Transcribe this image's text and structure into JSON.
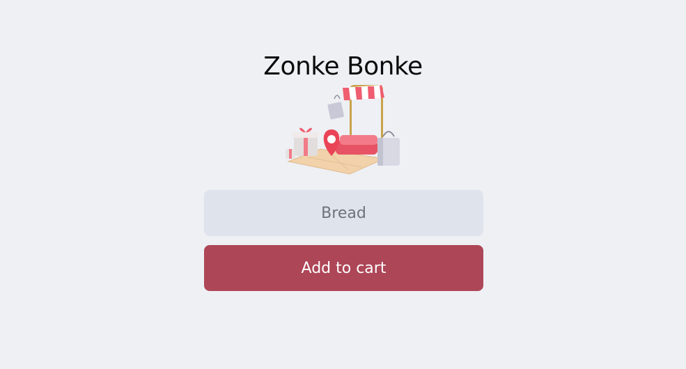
{
  "app": {
    "title": "Zonke Bonke"
  },
  "illustration": {
    "icon": "shop-storefront-illustration"
  },
  "item_input": {
    "value": "Bread"
  },
  "add_button": {
    "label": "Add to cart"
  },
  "colors": {
    "background": "#eef0f4",
    "input_bg": "#dfe3ec",
    "accent": "#ad4657"
  }
}
